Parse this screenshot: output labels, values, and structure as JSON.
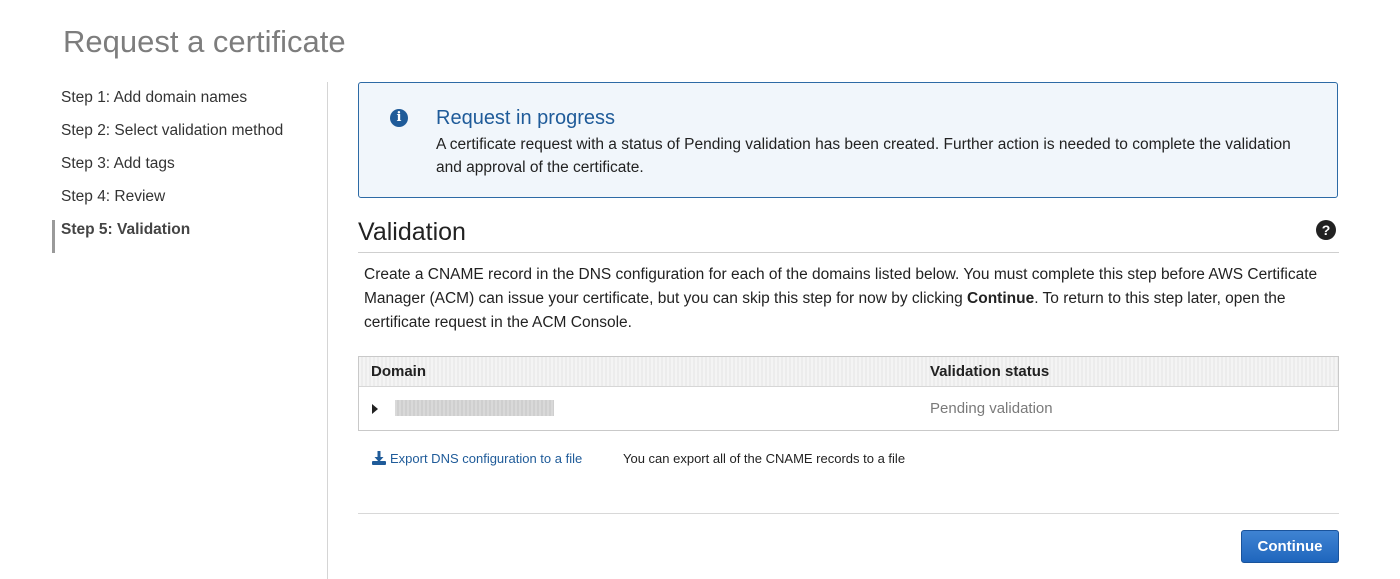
{
  "page": {
    "title": "Request a certificate"
  },
  "steps": [
    {
      "label": "Step 1: Add domain names"
    },
    {
      "label": "Step 2: Select validation method"
    },
    {
      "label": "Step 3: Add tags"
    },
    {
      "label": "Step 4: Review"
    },
    {
      "label": "Step 5: Validation",
      "active": true
    }
  ],
  "alert": {
    "icon": "info-icon",
    "title": "Request in progress",
    "message": "A certificate request with a status of Pending validation has been created. Further action is needed to complete the validation and approval of the certificate."
  },
  "validation": {
    "title": "Validation",
    "help_icon": "question-icon",
    "desc_part1": "Create a CNAME record in the DNS configuration for each of the domains listed below. You must complete this step before AWS Certificate Manager (ACM) can issue your certificate, but you can skip this step for now by clicking ",
    "desc_bold": "Continue",
    "desc_part2": ". To return to this step later, open the certificate request in the ACM Console."
  },
  "table": {
    "columns": [
      "Domain",
      "Validation status"
    ],
    "rows": [
      {
        "domain": "",
        "status": "Pending validation"
      }
    ]
  },
  "export": {
    "link_label": "Export DNS configuration to a file",
    "note": "You can export all of the CNAME records to a file"
  },
  "actions": {
    "continue_label": "Continue"
  },
  "colors": {
    "accent": "#1f5b99",
    "button": "#2a74c9",
    "alert_bg": "#f1f6fb"
  }
}
